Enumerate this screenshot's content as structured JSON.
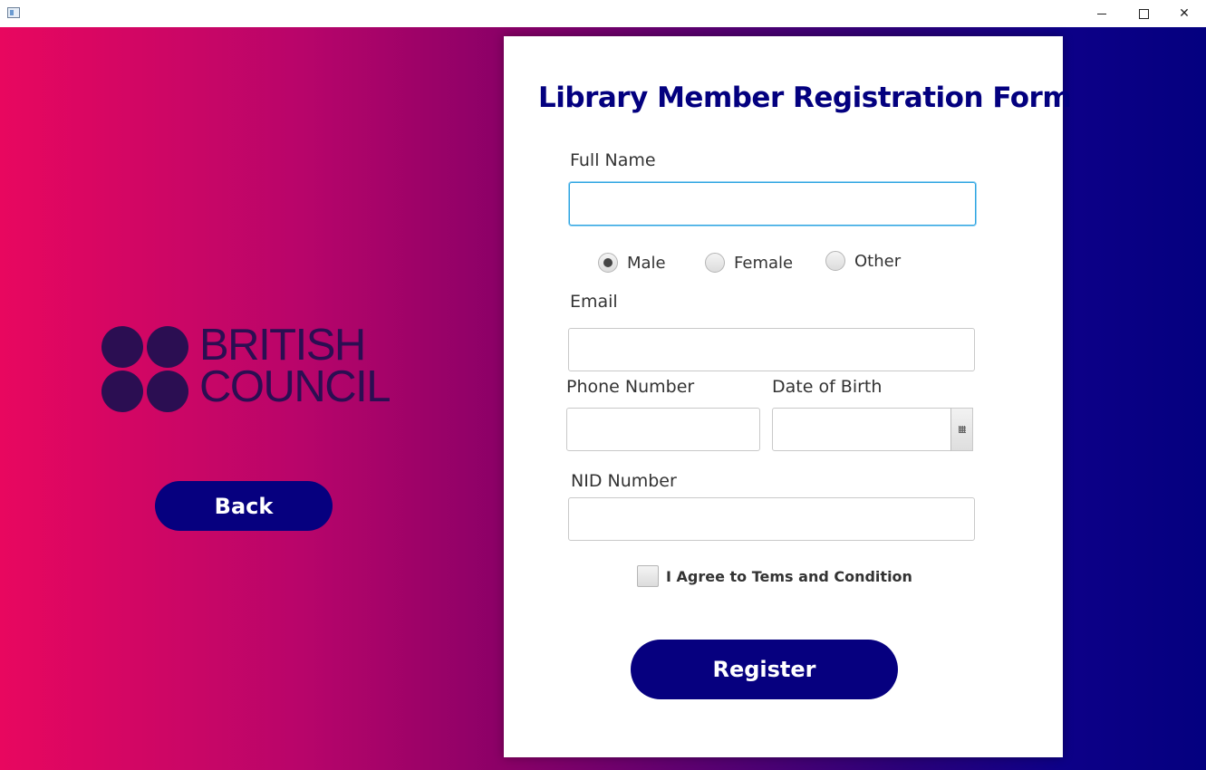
{
  "window": {
    "minimize_icon": "minimize-icon",
    "maximize_icon": "maximize-icon",
    "close_icon": "close-icon",
    "close_glyph": "✕"
  },
  "logo": {
    "line1": "BRITISH",
    "line2": "COUNCIL",
    "color": "#2b0e52"
  },
  "back_button": {
    "label": "Back"
  },
  "form": {
    "title": "Library Member Registration Form",
    "full_name": {
      "label": "Full Name",
      "value": ""
    },
    "gender": {
      "options": [
        {
          "label": "Male",
          "selected": true
        },
        {
          "label": "Female",
          "selected": false
        },
        {
          "label": "Other",
          "selected": false
        }
      ]
    },
    "email": {
      "label": "Email",
      "value": ""
    },
    "phone": {
      "label": "Phone Number",
      "value": ""
    },
    "dob": {
      "label": "Date of Birth",
      "value": "",
      "icon": "calendar-icon"
    },
    "nid": {
      "label": "NID Number",
      "value": ""
    },
    "agree": {
      "label": "I Agree to Tems and Condition",
      "checked": false
    },
    "register_label": "Register"
  },
  "colors": {
    "accent": "#06007f",
    "gradient_start": "#e8075f",
    "gradient_end": "#04007f",
    "focus_border": "#2da4e0"
  }
}
